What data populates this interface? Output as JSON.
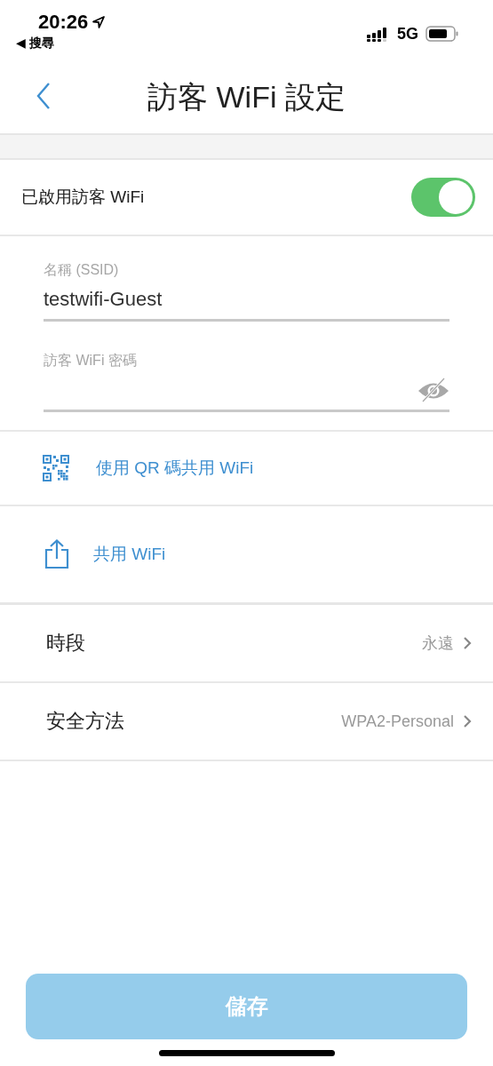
{
  "status_bar": {
    "time": "20:26",
    "back_app": "◀ 搜尋",
    "network": "5G"
  },
  "nav": {
    "title": "訪客 WiFi 設定"
  },
  "guest_wifi": {
    "label": "已啟用訪客 WiFi",
    "on": true
  },
  "fields": [
    {
      "label": "名稱 (SSID)",
      "value": "testwifi-Guest",
      "kind": "text"
    },
    {
      "label": "訪客 WiFi 密碼",
      "kind": "password"
    }
  ],
  "actions": [
    {
      "label": "使用 QR 碼共用 WiFi",
      "kind": "qr"
    },
    {
      "label": "共用 WiFi",
      "kind": "share"
    }
  ],
  "settings": [
    {
      "label": "時段",
      "value": "永遠"
    },
    {
      "label": "安全方法",
      "value": "WPA2-Personal"
    }
  ],
  "save_button": {
    "label": "儲存",
    "disabled": true
  }
}
